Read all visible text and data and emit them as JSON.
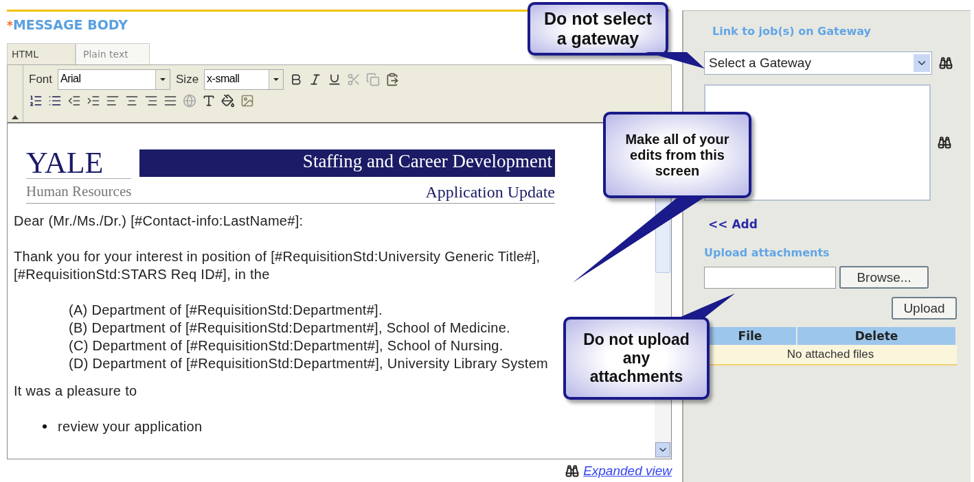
{
  "section_title": {
    "required_mark": "*",
    "label": "MESSAGE BODY"
  },
  "editor_tabs": [
    {
      "label": "HTML",
      "selected": true
    },
    {
      "label": "Plain text",
      "selected": false
    }
  ],
  "toolbar": {
    "font_label": "Font",
    "font_value": "Arial",
    "size_label": "Size",
    "size_value": "x-small"
  },
  "letterhead": {
    "logo": "YALE",
    "banner": "Staffing and Career Development",
    "department": "Human Resources",
    "subtitle": "Application Update"
  },
  "body": [
    {
      "kind": "para",
      "text": "Dear (Mr./Ms./Dr.) [#Contact-info:LastName#]:"
    },
    {
      "kind": "para",
      "text": "Thank you for your interest in position of [#RequisitionStd:University Generic Title#], [#RequisitionStd:STARS Req ID#], in the"
    },
    {
      "kind": "item",
      "text": "(A) Department of [#RequisitionStd:Department#]."
    },
    {
      "kind": "item",
      "text": "(B) Department of [#RequisitionStd:Department#], School of Medicine."
    },
    {
      "kind": "item",
      "text": "(C) Department of [#RequisitionStd:Department#], School of Nursing."
    },
    {
      "kind": "item",
      "text": "(D) Department of [#RequisitionStd:Department#], University Library System"
    },
    {
      "kind": "para",
      "text": "It was a pleasure to"
    },
    {
      "kind": "bullet",
      "text": "review your application"
    }
  ],
  "expanded_view_link": "Expanded view",
  "gateway": {
    "title": "Link to job(s) on Gateway",
    "select_value": "Select a Gateway",
    "add_link": "<< Add"
  },
  "attachments": {
    "title": "Upload attachments",
    "browse_button": "Browse...",
    "upload_button": "Upload",
    "columns": [
      "File",
      "Delete"
    ],
    "empty_text": "No attached files"
  },
  "callouts": [
    {
      "text": "Do not select a gateway"
    },
    {
      "text": "Make all of your edits from this screen"
    },
    {
      "text": "Do not upload any attachments"
    }
  ]
}
